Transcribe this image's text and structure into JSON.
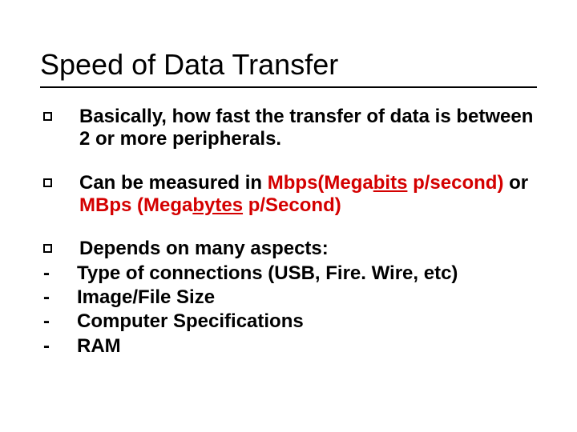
{
  "title": "Speed of Data Transfer",
  "bullets": {
    "b1": "Basically, how fast the transfer of data is between 2 or more peripherals.",
    "b2": {
      "pre": "Can be measured in ",
      "m1a": "Mbps(Mega",
      "m1u": "bits",
      "m1b": " p/second)",
      "mid": " or ",
      "m2a": "MBps (Mega",
      "m2u": "bytes",
      "m2b": " p/Second)"
    },
    "b3": "Depends on many aspects:",
    "d1": "Type of connections (USB, Fire. Wire, etc)",
    "d2": "Image/File Size",
    "d3": "Computer Specifications",
    "d4": "RAM"
  },
  "markers": {
    "dash": "-"
  }
}
